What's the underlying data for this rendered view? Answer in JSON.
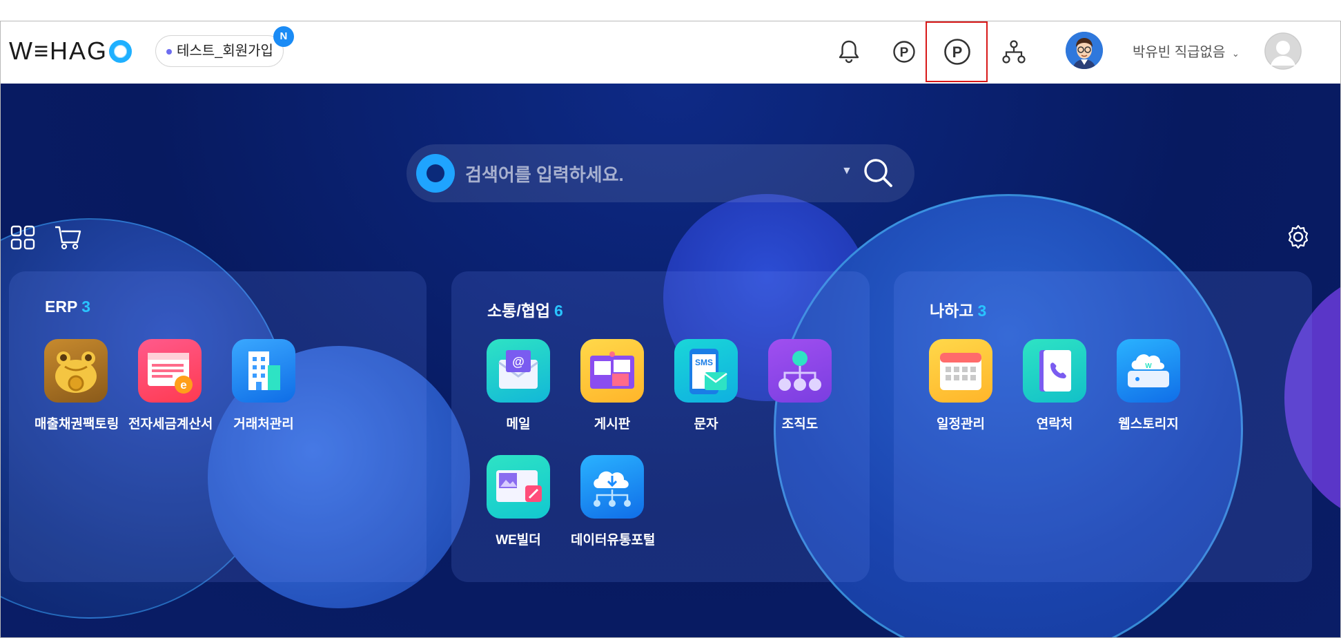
{
  "header": {
    "logo_text": "W≡HAG",
    "company": "테스트_회원가입",
    "new_badge": "N",
    "username": "박유빈 직급없음",
    "icons": [
      "bell-icon",
      "point-icon",
      "point-highlighted-icon",
      "org-icon"
    ]
  },
  "search": {
    "placeholder": "검색어를 입력하세요."
  },
  "cards": [
    {
      "title": "ERP",
      "count": "3",
      "apps": [
        {
          "label": "매출채권팩토링",
          "icon": "toad-icon",
          "color": "#e8a73a"
        },
        {
          "label": "전자세금계산서",
          "icon": "tax-invoice-icon",
          "color": "#ff4d6f"
        },
        {
          "label": "거래처관리",
          "icon": "building-icon",
          "color": "#1e8cff"
        }
      ]
    },
    {
      "title": "소통/협업",
      "count": "6",
      "apps": [
        {
          "label": "메일",
          "icon": "mail-icon",
          "color": "#18d1c8"
        },
        {
          "label": "게시판",
          "icon": "board-icon",
          "color": "#ffc83a"
        },
        {
          "label": "문자",
          "icon": "sms-icon",
          "color": "#14c8d8"
        },
        {
          "label": "조직도",
          "icon": "org-chart-icon",
          "color": "#8a4df0"
        },
        {
          "label": "WE빌더",
          "icon": "we-builder-icon",
          "color": "#1bd3b8"
        },
        {
          "label": "데이터유통포털",
          "icon": "data-portal-icon",
          "color": "#1a9cff"
        }
      ]
    },
    {
      "title": "나하고",
      "count": "3",
      "apps": [
        {
          "label": "일정관리",
          "icon": "calendar-icon",
          "color": "#ffc23a"
        },
        {
          "label": "연락처",
          "icon": "contacts-icon",
          "color": "#18cfc0"
        },
        {
          "label": "웹스토리지",
          "icon": "web-storage-icon",
          "color": "#1d8cff"
        }
      ]
    }
  ]
}
